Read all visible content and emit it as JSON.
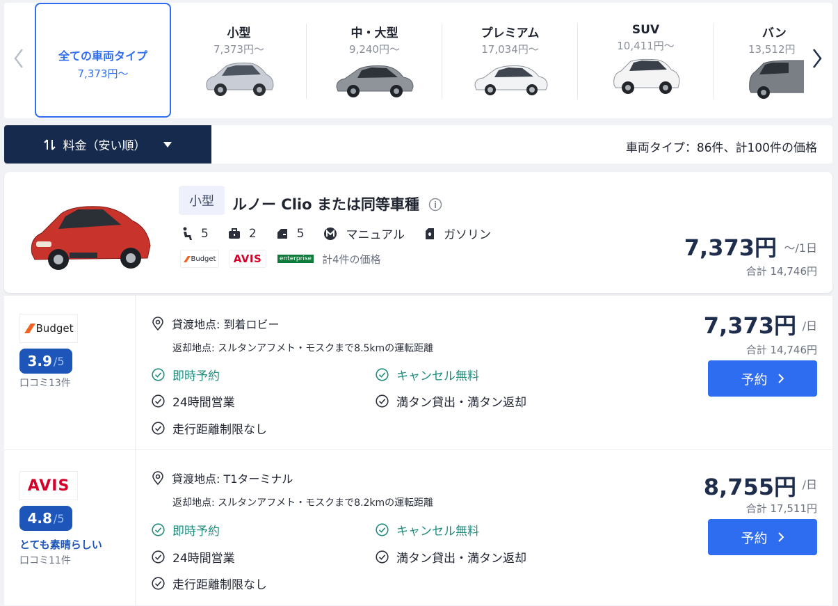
{
  "carousel": {
    "prev_icon": "chevron-left-icon",
    "next_icon": "chevron-right-icon",
    "all": {
      "name": "全ての車両タイプ",
      "price": "7,373円～"
    },
    "categories": [
      {
        "name": "小型",
        "price": "7,373円～",
        "car_color": "#c9ced6"
      },
      {
        "name": "中・大型",
        "price": "9,240円～",
        "car_color": "#8f949b"
      },
      {
        "name": "プレミアム",
        "price": "17,034円～",
        "car_color": "#f2f3f5"
      },
      {
        "name": "SUV",
        "price": "10,411円～",
        "car_color": "#f4f4f4"
      },
      {
        "name": "バン",
        "price": "13,512円",
        "car_color": "#7a7f86"
      }
    ]
  },
  "sort": {
    "label": "料金（安い順）",
    "icon": "sort-icon",
    "caret_icon": "caret-down-icon"
  },
  "result_count": "車両タイプ：86件、計100件の価格",
  "summary": {
    "category_tag": "小型",
    "title": "ルノー Clio または同等車種",
    "info_icon": "info-icon",
    "specs": {
      "seats": "5",
      "bags": "2",
      "doors": "5",
      "transmission": "マニュアル",
      "fuel": "ガソリン"
    },
    "vendors": [
      "Budget",
      "AVIS",
      "enterprise"
    ],
    "total_count": "計4件の価格",
    "price": "7,373円",
    "price_unit": "～/1日",
    "total": "合計 14,746円",
    "car_color": "#c8332c"
  },
  "offers": [
    {
      "vendor": "Budget",
      "rating": "3.9",
      "rating_max": "/5",
      "rating_text": "",
      "reviews": "口コミ13件",
      "pickup": "貸渡地点: 到着ロビー",
      "return": "返却地点: スルタンアフメト・モスクまで8.5kmの運転距離",
      "features": [
        "即時予約",
        "キャンセル無料",
        "24時間営業",
        "満タン貸出・満タン返却",
        "走行距離制限なし"
      ],
      "price": "7,373円",
      "unit": "/日",
      "total": "合計 14,746円",
      "book_label": "予約"
    },
    {
      "vendor": "AVIS",
      "rating": "4.8",
      "rating_max": "/5",
      "rating_text": "とても素晴らしい",
      "reviews": "口コミ11件",
      "pickup": "貸渡地点: T1ターミナル",
      "return": "返却地点: スルタンアフメト・モスクまで8.2kmの運転距離",
      "features": [
        "即時予約",
        "キャンセル無料",
        "24時間営業",
        "満タン貸出・満タン返却",
        "走行距離制限なし"
      ],
      "price": "8,755円",
      "unit": "/日",
      "total": "合計 17,511円",
      "book_label": "予約"
    }
  ]
}
